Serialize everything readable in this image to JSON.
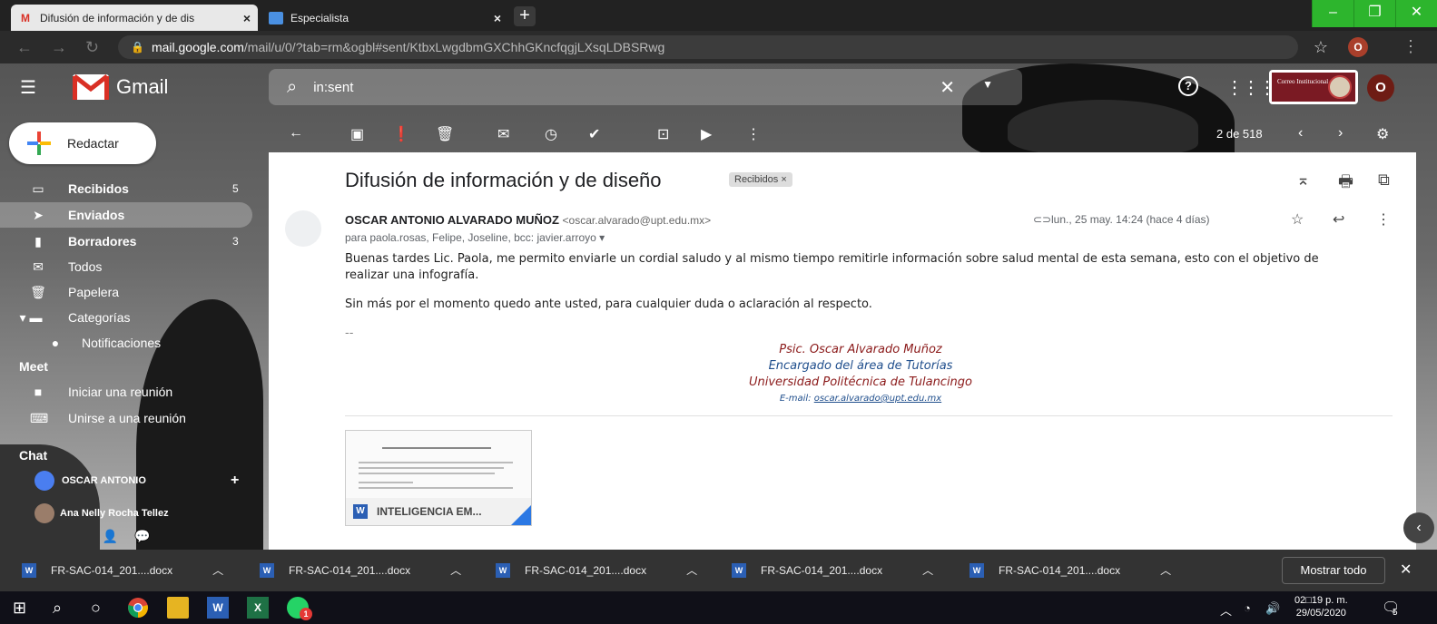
{
  "browser": {
    "tabs": [
      {
        "title": "Difusión de información y de dis",
        "icon": "gmail-icon",
        "active": true,
        "close": "×"
      },
      {
        "title": "Especialista",
        "icon": "document-icon",
        "active": false,
        "close": "×"
      }
    ],
    "new_tab": "+",
    "url_host": "mail.google.com",
    "url_path": "/mail/u/0/?tab=rm&ogbl#sent/KtbxLwgdbmGXChhGKncfqgjLXsqLDBSRwg",
    "profile_initial": "O"
  },
  "gmail": {
    "app_name": "Gmail",
    "search_value": "in:sent",
    "brand_text": "Correo Institucional",
    "avatar_initial": "O",
    "compose_label": "Redactar",
    "nav": [
      {
        "label": "Recibidos",
        "count": "5",
        "icon": "inbox-icon",
        "bold": true
      },
      {
        "label": "Enviados",
        "count": "",
        "icon": "send-icon",
        "bold": true
      },
      {
        "label": "Borradores",
        "count": "3",
        "icon": "draft-icon",
        "bold": true
      },
      {
        "label": "Todos",
        "count": "",
        "icon": "mail-icon",
        "bold": false
      },
      {
        "label": "Papelera",
        "count": "",
        "icon": "trash-icon",
        "bold": false
      },
      {
        "label": "Categorías",
        "count": "",
        "icon": "label-icon",
        "bold": false
      },
      {
        "label": "Notificaciones",
        "count": "",
        "icon": "info-icon",
        "bold": false
      }
    ],
    "meet_title": "Meet",
    "meet_items": [
      "Iniciar una reunión",
      "Unirse a una reunión"
    ],
    "chat_title": "Chat",
    "chat_users": [
      "OSCAR ANTONIO",
      "Ana Nelly Rocha Tellez"
    ],
    "page_info": "2 de 518"
  },
  "message": {
    "subject": "Difusión de información y de diseño",
    "label_chip": "Recibidos ×",
    "sender_name": "OSCAR ANTONIO ALVARADO MUÑOZ",
    "sender_email": "<oscar.alvarado@upt.edu.mx>",
    "recipients": "para paola.rosas, Felipe, Joseline, bcc: javier.arroyo ▾",
    "date": "lun., 25 may. 14:24 (hace 4 días)",
    "body_1": "Buenas tardes Lic. Paola, me permito enviarle un cordial saludo y al mismo tiempo remitirle información sobre salud mental de esta semana, esto con el objetivo de",
    "body_2": "realizar una infografía.",
    "body_3": "Sin más por el momento quedo ante usted, para cualquier duda o aclaración al respecto.",
    "separator": "--",
    "signature": [
      {
        "text": "Psic. Oscar Alvarado Muñoz",
        "color": "#8b1a1a"
      },
      {
        "text": "Encargado del área de Tutorías",
        "color": "#1f4e8c"
      },
      {
        "text": "Universidad Politécnica de Tulancingo",
        "color": "#8b1a1a"
      }
    ],
    "sig_email_prefix": "E-mail: ",
    "sig_email": "oscar.alvarado@upt.edu.mx",
    "attachment_name": "INTELIGENCIA EM...",
    "attachment_badge": "W"
  },
  "downloads": {
    "files": [
      "FR-SAC-014_201....docx",
      "FR-SAC-014_201....docx",
      "FR-SAC-014_201....docx",
      "FR-SAC-014_201....docx",
      "FR-SAC-014_201....docx"
    ],
    "show_all": "Mostrar todo"
  },
  "taskbar": {
    "time": "02□19 p. m.",
    "date": "29/05/2020",
    "notif_count": "5",
    "whatsapp_badge": "1"
  }
}
